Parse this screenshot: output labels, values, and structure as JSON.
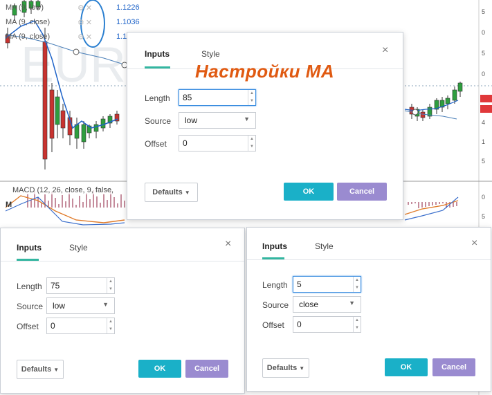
{
  "chart": {
    "indicator_rows": [
      {
        "label": "MA (9, low)",
        "value": "1.1226"
      },
      {
        "label": "MA (9, close)",
        "value": "1.1036"
      },
      {
        "label": "MA (9, close)",
        "value": "1.1"
      }
    ],
    "watermark": "EUR 40",
    "macd_label": "MACD (12, 26, close, 9, false,",
    "macd_marker": "M",
    "price_axis_ticks": [
      "5",
      "0",
      "5",
      "0",
      "5",
      "0",
      "4",
      "1",
      "5",
      "0",
      "5"
    ]
  },
  "overlay_title": "Настройки МА",
  "dialogs": [
    {
      "tabs": [
        {
          "label": "Inputs",
          "active": true
        },
        {
          "label": "Style",
          "active": false
        }
      ],
      "close_icon": "close-icon",
      "length_label": "Length",
      "length_value": "85",
      "source_label": "Source",
      "source_value": "low",
      "offset_label": "Offset",
      "offset_value": "0",
      "defaults_label": "Defaults",
      "ok_label": "OK",
      "cancel_label": "Cancel"
    },
    {
      "tabs": [
        {
          "label": "Inputs",
          "active": true
        },
        {
          "label": "Style",
          "active": false
        }
      ],
      "close_icon": "close-icon",
      "length_label": "Length",
      "length_value": "75",
      "source_label": "Source",
      "source_value": "low",
      "offset_label": "Offset",
      "offset_value": "0",
      "defaults_label": "Defaults",
      "ok_label": "OK",
      "cancel_label": "Cancel"
    },
    {
      "tabs": [
        {
          "label": "Inputs",
          "active": true
        },
        {
          "label": "Style",
          "active": false
        }
      ],
      "close_icon": "close-icon",
      "length_label": "Length",
      "length_value": "5",
      "source_label": "Source",
      "source_value": "close",
      "offset_label": "Offset",
      "offset_value": "0",
      "defaults_label": "Defaults",
      "ok_label": "OK",
      "cancel_label": "Cancel"
    }
  ],
  "colors": {
    "accent_tab": "#33b6a0",
    "ok_button": "#1ab0c8",
    "cancel_button": "#9a8bd0",
    "title_orange": "#e05a12",
    "ma_line": "#1e63c8",
    "candle_up": "#2e9e3e",
    "candle_down": "#c8332f"
  }
}
